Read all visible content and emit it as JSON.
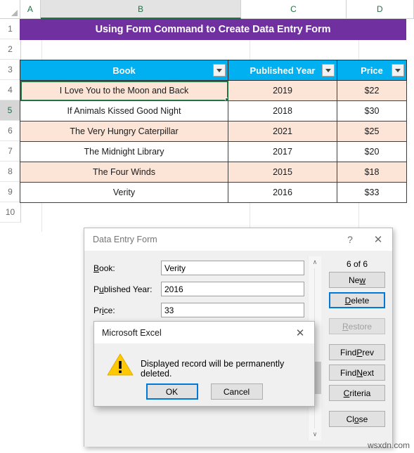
{
  "spreadsheet": {
    "column_headers": [
      "A",
      "B",
      "C",
      "D"
    ],
    "selected_column": "B",
    "row_headers": [
      "1",
      "2",
      "3",
      "4",
      "5",
      "6",
      "7",
      "8",
      "9",
      "10"
    ],
    "selected_row": "5",
    "banner_title": "Using Form Command to Create Data Entry Form",
    "banner_color": "#7030A0",
    "header_color": "#00B0F0",
    "band_color": "#FCE4D6",
    "table": {
      "columns": [
        "Book",
        "Published Year",
        "Price"
      ],
      "rows": [
        {
          "book": "I Love You to the Moon and Back",
          "year": "2019",
          "price": "$22"
        },
        {
          "book": "If Animals Kissed Good Night",
          "year": "2018",
          "price": "$30"
        },
        {
          "book": "The Very Hungry Caterpillar",
          "year": "2021",
          "price": "$25"
        },
        {
          "book": "The Midnight Library",
          "year": "2017",
          "price": "$20"
        },
        {
          "book": "The Four Winds",
          "year": "2015",
          "price": "$18"
        },
        {
          "book": "Verity",
          "year": "2016",
          "price": "$33"
        }
      ]
    }
  },
  "form_dialog": {
    "title": "Data Entry Form",
    "help_label": "?",
    "close_label": "✕",
    "fields": [
      {
        "label_pre": "",
        "label_accel": "B",
        "label_post": "ook:",
        "value": "Verity"
      },
      {
        "label_pre": "P",
        "label_accel": "u",
        "label_post": "blished Year:",
        "value": "2016"
      },
      {
        "label_pre": "Pr",
        "label_accel": "i",
        "label_post": "ce:",
        "value": "33"
      }
    ],
    "record_count": "6 of 6",
    "buttons": [
      {
        "pre": "Ne",
        "accel": "w",
        "post": "",
        "state": "normal"
      },
      {
        "pre": "",
        "accel": "D",
        "post": "elete",
        "state": "focused"
      },
      {
        "pre": "",
        "accel": "R",
        "post": "estore",
        "state": "disabled"
      },
      {
        "pre": "Find ",
        "accel": "P",
        "post": "rev",
        "state": "normal"
      },
      {
        "pre": "Find ",
        "accel": "N",
        "post": "ext",
        "state": "normal"
      },
      {
        "pre": "",
        "accel": "C",
        "post": "riteria",
        "state": "normal"
      },
      {
        "pre": "Cl",
        "accel": "o",
        "post": "se",
        "state": "normal"
      }
    ],
    "scrollbar": {
      "up_arrow": "∧",
      "down_arrow": "∨"
    }
  },
  "message_box": {
    "title": "Microsoft Excel",
    "close_label": "✕",
    "icon": "warning-triangle",
    "message": "Displayed record will be permanently deleted.",
    "ok_label": "OK",
    "cancel_label": "Cancel",
    "focus_color": "#0078D7"
  },
  "watermark": "wsxdn.com"
}
